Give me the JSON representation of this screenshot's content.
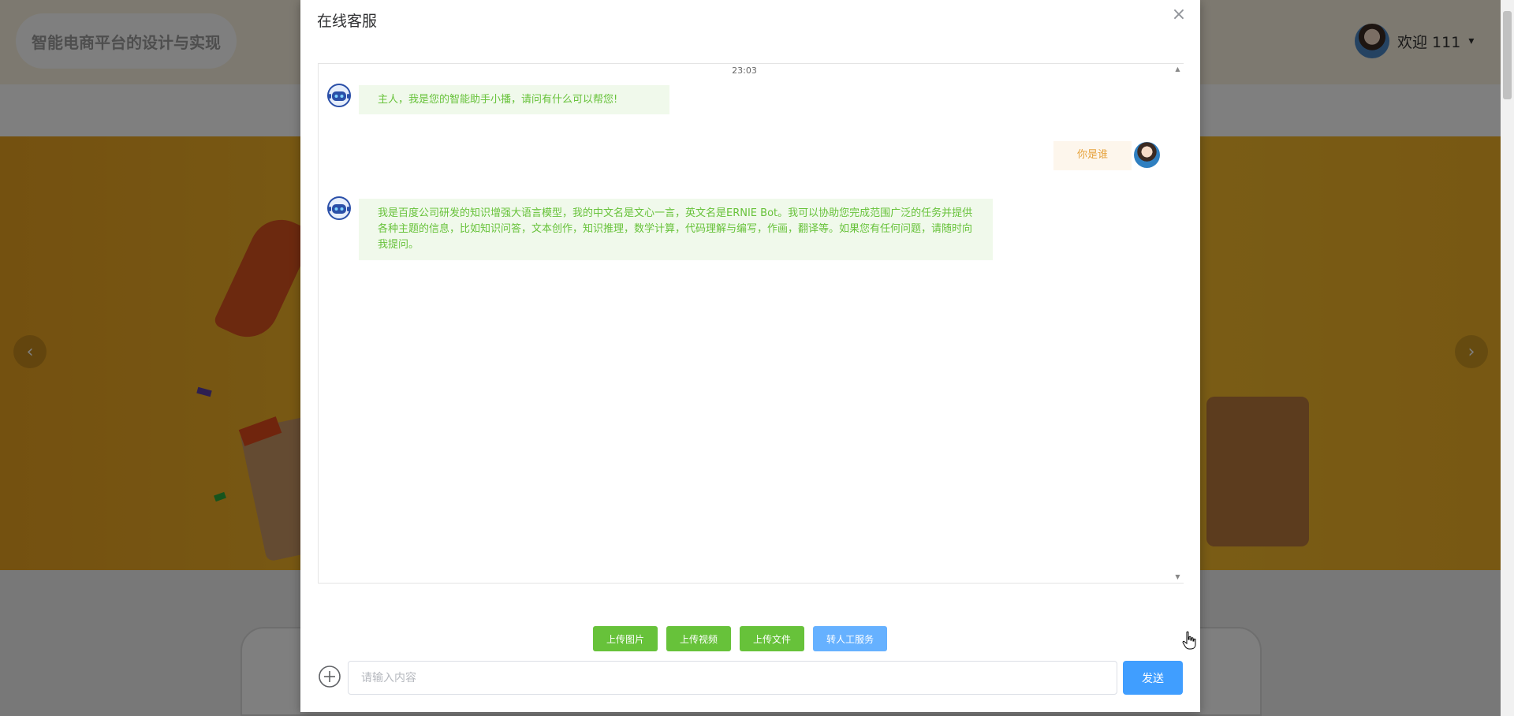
{
  "site": {
    "title": "智能电商平台的设计与实现",
    "welcome": "欢迎 111",
    "caret": "▾",
    "prev_arrow": "‹",
    "next_arrow": "›"
  },
  "dialog": {
    "title": "在线客服",
    "close_glyph": "×",
    "timestamp": "23:03",
    "messages": [
      {
        "role": "bot",
        "text": "主人，我是您的智能助手小播，请问有什么可以帮您!"
      },
      {
        "role": "user",
        "text": "你是谁"
      },
      {
        "role": "bot",
        "text": "我是百度公司研发的知识增强大语言模型，我的中文名是文心一言，英文名是ERNIE Bot。我可以协助您完成范围广泛的任务并提供各种主题的信息，比如知识问答，文本创作，知识推理，数学计算，代码理解与编写，作画，翻译等。如果您有任何问题，请随时向我提问。"
      }
    ],
    "actions": {
      "upload_image": "上传图片",
      "upload_video": "上传视频",
      "upload_file": "上传文件",
      "transfer_human": "转人工服务"
    },
    "input_placeholder": "请输入内容",
    "send_label": "发送"
  },
  "colors": {
    "primary": "#409eff",
    "success": "#67c23a",
    "warning": "#e6a23c"
  }
}
